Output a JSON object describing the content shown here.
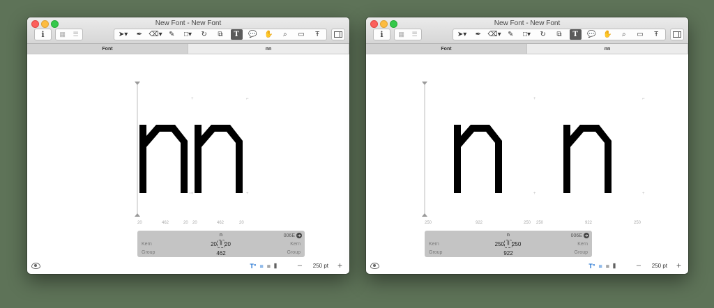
{
  "windows": [
    {
      "title": "New Font - New Font",
      "tabs": [
        {
          "label": "Font"
        },
        {
          "label": "nn"
        }
      ],
      "inspector": {
        "glyph": "n",
        "code": "006E",
        "kern_left": "Kern",
        "kern_right": "Kern",
        "group_left": "Group",
        "group_right": "Group",
        "lsb": "20",
        "rsb": "20",
        "width": "462"
      },
      "metrics": [
        "20",
        "462",
        "20",
        "20",
        "462",
        "20"
      ],
      "zoom": "250 pt"
    },
    {
      "title": "New Font - New Font",
      "tabs": [
        {
          "label": "Font"
        },
        {
          "label": "nn"
        }
      ],
      "inspector": {
        "glyph": "n",
        "code": "006E",
        "kern_left": "Kern",
        "kern_right": "Kern",
        "group_left": "Group",
        "group_right": "Group",
        "lsb": "250",
        "rsb": "250",
        "width": "922"
      },
      "metrics": [
        "250",
        "922",
        "250",
        "250",
        "922",
        "250"
      ],
      "zoom": "250 pt"
    }
  ],
  "icons": {
    "toolbar": [
      "info-icon",
      "grid-view-icon",
      "list-view-icon",
      "select-icon",
      "draw-icon",
      "eraser-icon",
      "pencil-icon",
      "rectangle-icon",
      "rotate-icon",
      "scale-icon",
      "text-icon",
      "annotation-icon",
      "hand-icon",
      "zoom-icon",
      "measure-icon",
      "metrics-icon",
      "sidebar-toggle-icon"
    ],
    "status": [
      "eye-icon",
      "text-tool-icon",
      "align-left-icon",
      "align-right-icon",
      "align-justify-icon"
    ]
  },
  "colors": {
    "desktop": "#5e7358",
    "active_tool": "#5b5b5b",
    "accent": "#1a6fd1"
  }
}
